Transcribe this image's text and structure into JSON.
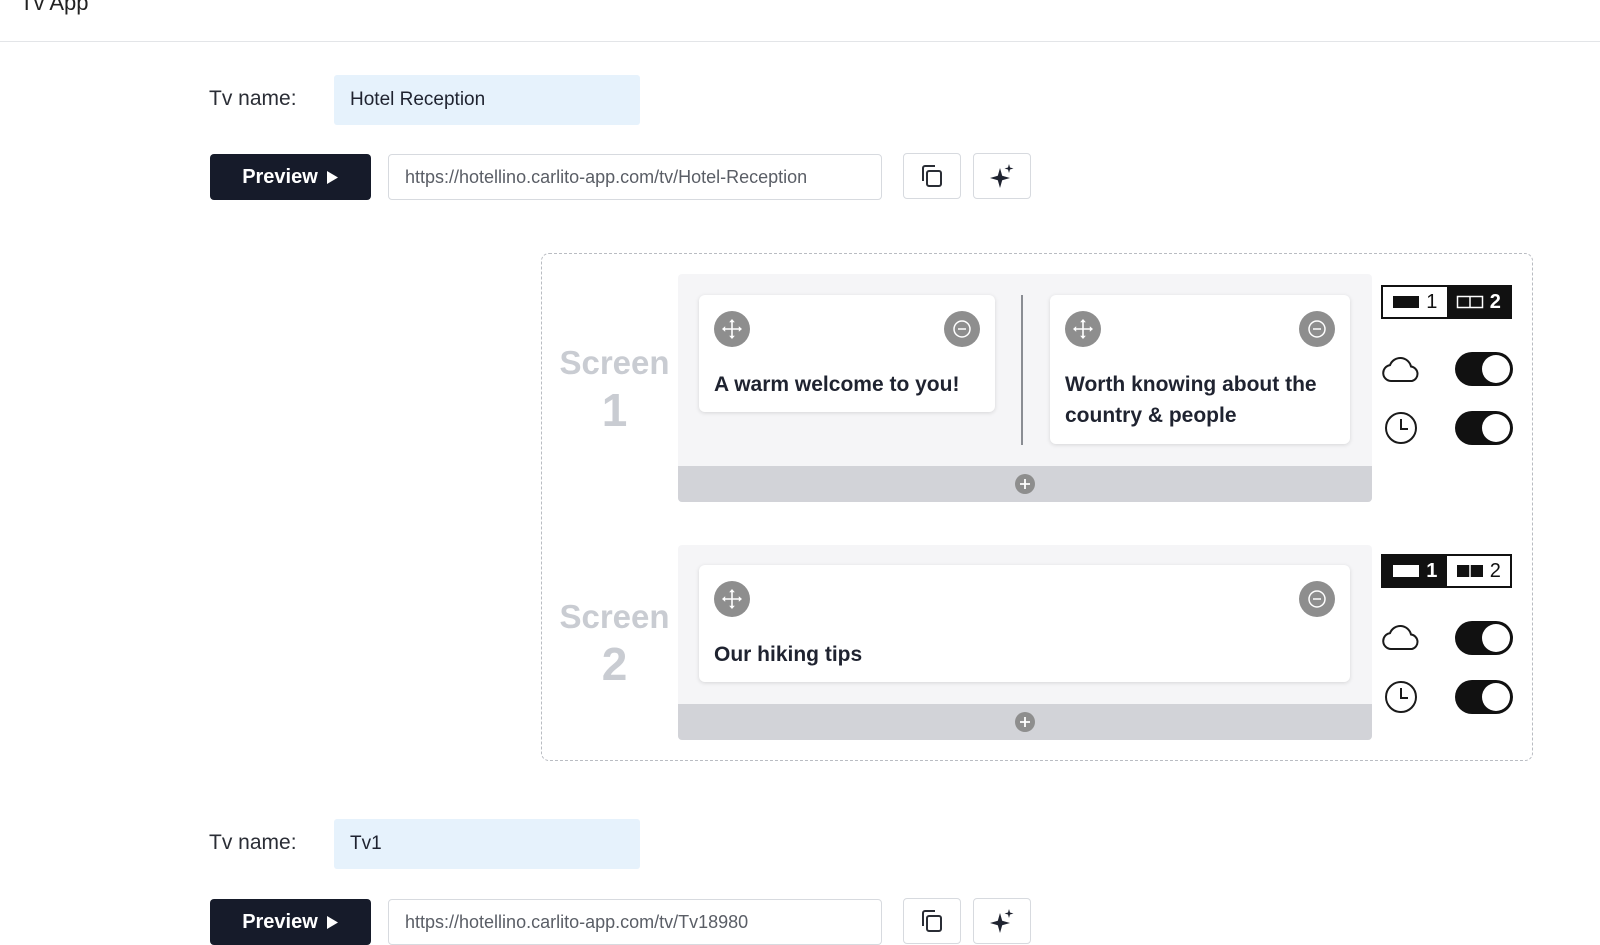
{
  "app": {
    "title": "Tv App"
  },
  "tvs": [
    {
      "name_label": "Tv name:",
      "name_value": "Hotel Reception",
      "preview_label": "Preview",
      "url": "https://hotellino.carlito-app.com/tv/Hotel-Reception",
      "screen_word": "Screen",
      "screens": [
        {
          "number": "1",
          "cards": [
            {
              "title": "A warm welcome to you!"
            },
            {
              "title": "Worth knowing about the country & people"
            }
          ],
          "layout_options": [
            "1",
            "2"
          ],
          "active_layout": "2",
          "weather_enabled": true,
          "clock_enabled": true
        },
        {
          "number": "2",
          "cards": [
            {
              "title": "Our hiking tips"
            }
          ],
          "layout_options": [
            "1",
            "2"
          ],
          "active_layout": "1",
          "weather_enabled": true,
          "clock_enabled": true
        }
      ]
    },
    {
      "name_label": "Tv name:",
      "name_value": "Tv1",
      "preview_label": "Preview",
      "url": "https://hotellino.carlito-app.com/tv/Tv18980"
    }
  ],
  "icons": {
    "copy": "copy-icon",
    "magic": "sparkle-icon",
    "move": "move-icon",
    "remove": "minus-circle-icon",
    "add": "plus-circle-icon",
    "weather": "cloud-icon",
    "clock": "clock-icon",
    "play": "play-icon"
  },
  "colors": {
    "primary_dark": "#161b2a",
    "input_bg": "#e6f2fc",
    "panel_bg": "#f5f5f7",
    "add_bar": "#d2d3d8",
    "card_icon": "#8e8e8e",
    "screen_label": "#c9ccd2"
  }
}
